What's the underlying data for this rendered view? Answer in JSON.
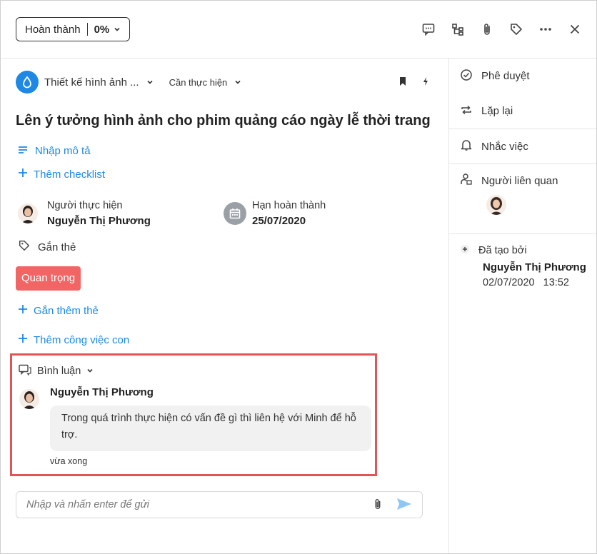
{
  "toolbar": {
    "status_label": "Hoàn thành",
    "status_percent": "0%"
  },
  "task": {
    "project_name": "Thiết kế hình ảnh ...",
    "stage": "Cần thực hiện",
    "title": "Lên ý tưởng hình ảnh cho phim quảng cáo ngày lễ thời trang",
    "add_description": "Nhập mô tả",
    "add_checklist": "Thêm checklist",
    "assignee_label": "Người thực hiện",
    "assignee_name": "Nguyễn Thị Phương",
    "deadline_label": "Hạn hoàn thành",
    "deadline_value": "25/07/2020",
    "tags_label": "Gắn thẻ",
    "tag": "Quan trọng",
    "add_tag": "Gắn thêm thẻ",
    "add_subtask": "Thêm công việc con"
  },
  "comments": {
    "header": "Bình luận",
    "items": [
      {
        "author": "Nguyễn Thị Phương",
        "text": "Trong quá trình thực hiện có vấn đề gì thì liên hệ với Minh để hỗ trợ.",
        "time": "vừa xong"
      }
    ],
    "input_placeholder": "Nhập và nhấn enter để gửi"
  },
  "sidebar": {
    "approve": "Phê duyệt",
    "repeat": "Lặp lại",
    "reminder": "Nhắc việc",
    "related": "Người liên quan",
    "created_by_label": "Đã tạo bởi",
    "created_by_name": "Nguyễn Thị Phương",
    "created_date": "02/07/2020",
    "created_time": "13:52"
  },
  "colors": {
    "accent": "#1e88e5",
    "tag": "#f26565",
    "highlight": "#e05656"
  }
}
